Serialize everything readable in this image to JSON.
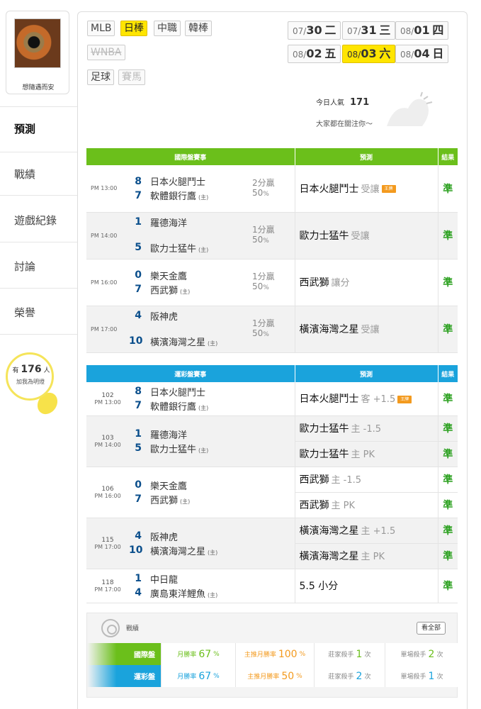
{
  "user": {
    "name": "想隨遇而安"
  },
  "nav": [
    {
      "label": "預測"
    },
    {
      "label": "戰績"
    },
    {
      "label": "遊戲紀錄"
    },
    {
      "label": "討論"
    },
    {
      "label": "榮譽"
    }
  ],
  "likes": {
    "prefix": "有",
    "count": "176",
    "suffix": "人",
    "text": "加我為明燈"
  },
  "sports": [
    "MLB",
    "日棒",
    "中職",
    "韓棒",
    "WNBA",
    "足球",
    "賽馬"
  ],
  "dates": [
    {
      "md": "07/",
      "d": "30",
      "w": "二"
    },
    {
      "md": "07/",
      "d": "31",
      "w": "三"
    },
    {
      "md": "08/",
      "d": "01",
      "w": "四"
    },
    {
      "md": "08/",
      "d": "02",
      "w": "五"
    },
    {
      "md": "08/",
      "d": "03",
      "w": "六"
    },
    {
      "md": "08/",
      "d": "04",
      "w": "日"
    }
  ],
  "popularity": {
    "label": "今日人氣",
    "value": "171",
    "sub": "大家都在關注你～"
  },
  "intl": {
    "headers": [
      "國際盤賽事",
      "預測",
      "結果"
    ],
    "rows": [
      {
        "time": "PM 13:00",
        "s1": "8",
        "t1": "日本火腿鬥士",
        "s2": "7",
        "t2": "軟體銀行鷹",
        "home": "(主)",
        "odds1": "2分贏",
        "odds2": "50",
        "pct": "%",
        "pred": "日本火腿鬥士",
        "sub": "受讓",
        "badge": "王牌",
        "result": "準"
      },
      {
        "time": "PM 14:00",
        "s1": "1",
        "t1": "羅德海洋",
        "s2": "5",
        "t2": "歐力士猛牛",
        "home": "(主)",
        "odds1": "1分贏",
        "odds2": "50",
        "pct": "%",
        "pred": "歐力士猛牛",
        "sub": "受讓",
        "badge": "",
        "result": "準"
      },
      {
        "time": "PM 16:00",
        "s1": "0",
        "t1": "樂天金鷹",
        "s2": "7",
        "t2": "西武獅",
        "home": "(主)",
        "odds1": "1分贏",
        "odds2": "50",
        "pct": "%",
        "pred": "西武獅",
        "sub": "讓分",
        "badge": "",
        "result": "準"
      },
      {
        "time": "PM 17:00",
        "s1": "4",
        "t1": "阪神虎",
        "s2": "10",
        "t2": "橫濱海灣之星",
        "home": "(主)",
        "odds1": "1分贏",
        "odds2": "50",
        "pct": "%",
        "pred": "橫濱海灣之星",
        "sub": "受讓",
        "badge": "",
        "result": "準"
      }
    ]
  },
  "lottery": {
    "headers": [
      "運彩盤賽事",
      "預測",
      "結果"
    ],
    "rows": [
      {
        "num": "102",
        "time": "PM 13:00",
        "s1": "8",
        "t1": "日本火腿鬥士",
        "s2": "7",
        "t2": "軟體銀行鷹",
        "home": "(主)",
        "preds": [
          {
            "pred": "日本火腿鬥士",
            "sub": "客 +1.5",
            "badge": "王牌",
            "result": "準"
          }
        ]
      },
      {
        "num": "103",
        "time": "PM 14:00",
        "s1": "1",
        "t1": "羅德海洋",
        "s2": "5",
        "t2": "歐力士猛牛",
        "home": "(主)",
        "preds": [
          {
            "pred": "歐力士猛牛",
            "sub": "主 -1.5",
            "badge": "",
            "result": "準"
          },
          {
            "pred": "歐力士猛牛",
            "sub": "主 PK",
            "badge": "",
            "result": "準"
          }
        ]
      },
      {
        "num": "106",
        "time": "PM 16:00",
        "s1": "0",
        "t1": "樂天金鷹",
        "s2": "7",
        "t2": "西武獅",
        "home": "(主)",
        "preds": [
          {
            "pred": "西武獅",
            "sub": "主 -1.5",
            "badge": "",
            "result": "準"
          },
          {
            "pred": "西武獅",
            "sub": "主 PK",
            "badge": "",
            "result": "準"
          }
        ]
      },
      {
        "num": "115",
        "time": "PM 17:00",
        "s1": "4",
        "t1": "阪神虎",
        "s2": "10",
        "t2": "橫濱海灣之星",
        "home": "(主)",
        "preds": [
          {
            "pred": "橫濱海灣之星",
            "sub": "主 +1.5",
            "badge": "",
            "result": "準"
          },
          {
            "pred": "橫濱海灣之星",
            "sub": "主 PK",
            "badge": "",
            "result": "準"
          }
        ]
      },
      {
        "num": "118",
        "time": "PM 17:00",
        "s1": "1",
        "t1": "中日龍",
        "s2": "4",
        "t2": "廣島東洋鯉魚",
        "home": "(主)",
        "preds": [
          {
            "pred": "5.5 小分",
            "sub": "",
            "badge": "",
            "result": "準"
          }
        ]
      }
    ]
  },
  "stats": {
    "title": "戰績",
    "view_all": "看全部",
    "rows": [
      {
        "label": "國際盤",
        "color": "#6bbf1b",
        "monthly_label": "月勝率",
        "monthly": "67",
        "main_label": "主推月勝率",
        "main": "100",
        "banker_label": "莊家殺手",
        "banker": "1",
        "single_label": "單場殺手",
        "single": "2",
        "unit_pct": "%",
        "unit_times": "次"
      },
      {
        "label": "運彩盤",
        "color": "#1aa3dc",
        "monthly_label": "月勝率",
        "monthly": "67",
        "main_label": "主推月勝率",
        "main": "50",
        "banker_label": "莊家殺手",
        "banker": "2",
        "single_label": "單場殺手",
        "single": "1",
        "unit_pct": "%",
        "unit_times": "次"
      }
    ]
  },
  "colors": {
    "green": "#6bbf1b",
    "blue": "#1aa3dc",
    "yellow": "#ffe500",
    "win": "#2aa01e",
    "score": "#0b4f8c",
    "orange": "#f39a1e"
  }
}
